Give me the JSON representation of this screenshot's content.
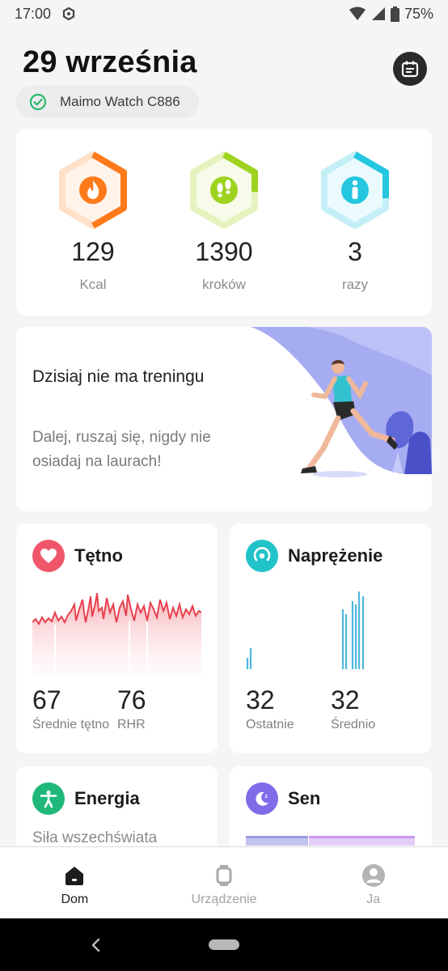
{
  "status_bar": {
    "time": "17:00",
    "battery": "75%"
  },
  "header": {
    "date": "29 września",
    "device_name": "Maimo Watch C886"
  },
  "stats": [
    {
      "value": "129",
      "unit": "Kcal",
      "color": "#ff7a1a",
      "icon": "flame-icon"
    },
    {
      "value": "1390",
      "unit": "kroków",
      "color": "#9ed21f",
      "icon": "footsteps-icon"
    },
    {
      "value": "3",
      "unit": "razy",
      "color": "#25c6e0",
      "icon": "standing-person-icon"
    }
  ],
  "workout": {
    "title": "Dzisiaj nie ma treningu",
    "text": "Dalej, ruszaj się, nigdy nie osiadaj na laurach!"
  },
  "heart_rate": {
    "title": "Tętno",
    "avg_value": "67",
    "avg_label": "Średnie tętno",
    "rhr_value": "76",
    "rhr_label": "RHR",
    "color": "#f0566a"
  },
  "stress": {
    "title": "Naprężenie",
    "last_value": "32",
    "last_label": "Ostatnie",
    "avg_value": "32",
    "avg_label": "Średnio",
    "color": "#22c3c8"
  },
  "energy": {
    "title": "Energia",
    "subtitle": "Siła wszechświata",
    "color": "#1fb87a"
  },
  "sleep": {
    "title": "Sen",
    "color": "#7e6ce8"
  },
  "bottom_nav": [
    {
      "label": "Dom",
      "active": true
    },
    {
      "label": "Urządzenie",
      "active": false
    },
    {
      "label": "Ja",
      "active": false
    }
  ]
}
